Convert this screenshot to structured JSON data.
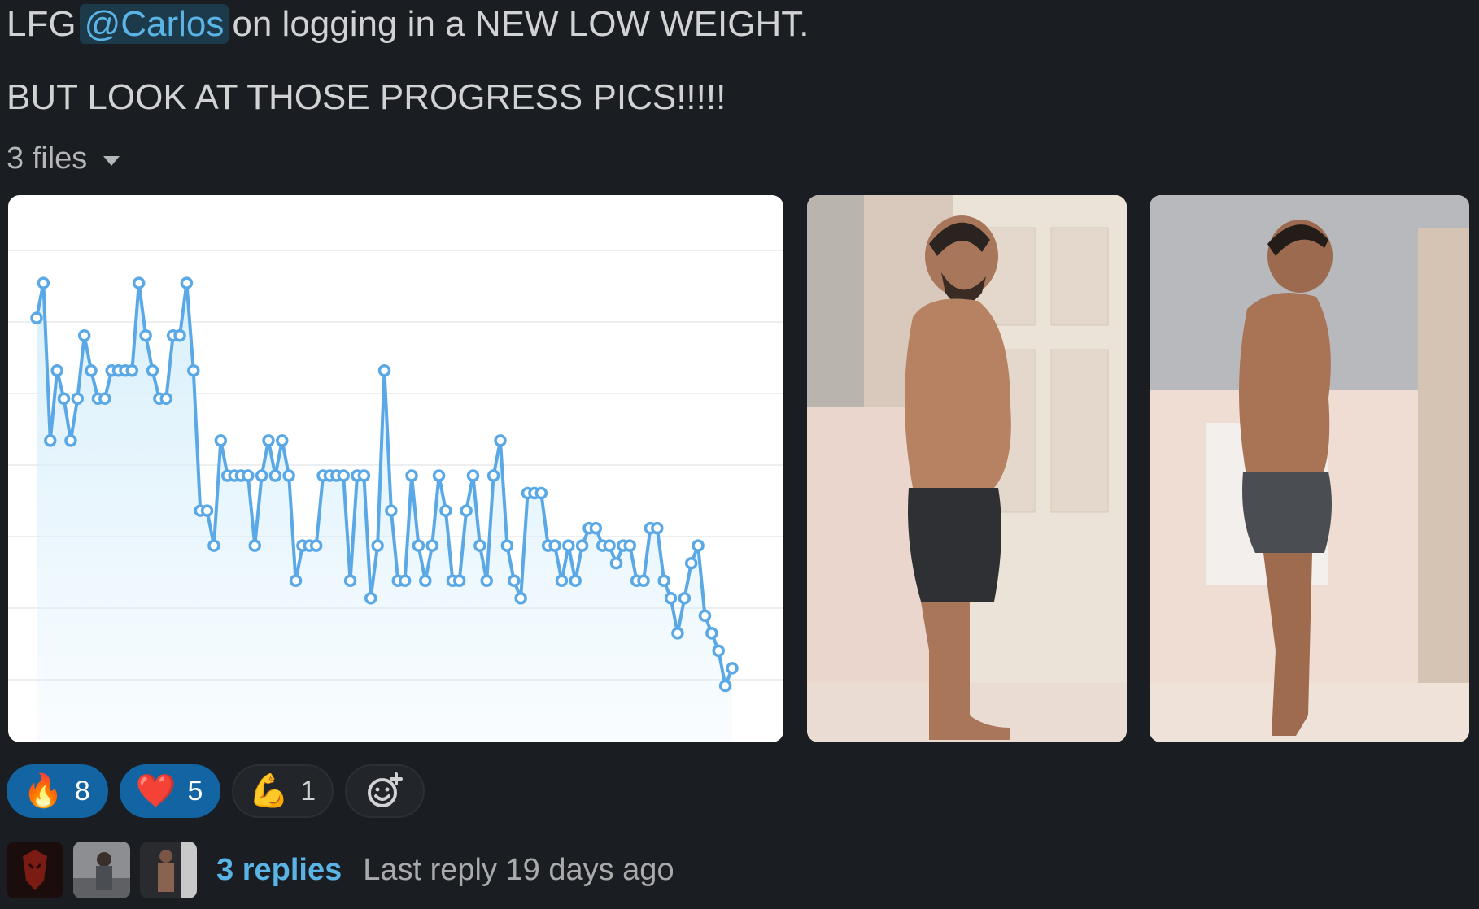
{
  "message": {
    "line1_before": "LFG",
    "mention": "@Carlos",
    "line1_after": "on logging in a NEW LOW WEIGHT.",
    "line2": "BUT LOOK AT THOSE PROGRESS PICS!!!!!",
    "files_label": "3 files"
  },
  "chart_data": {
    "type": "area",
    "values": [
      80,
      90,
      45,
      65,
      57,
      45,
      57,
      75,
      65,
      57,
      57,
      65,
      65,
      65,
      65,
      90,
      75,
      65,
      57,
      57,
      75,
      75,
      90,
      65,
      25,
      25,
      15,
      45,
      35,
      35,
      35,
      35,
      15,
      35,
      45,
      35,
      45,
      35,
      5,
      15,
      15,
      15,
      35,
      35,
      35,
      35,
      5,
      35,
      35,
      0,
      15,
      65,
      25,
      5,
      5,
      35,
      15,
      5,
      15,
      35,
      25,
      5,
      5,
      25,
      35,
      15,
      5,
      35,
      45,
      15,
      5,
      0,
      30,
      30,
      30,
      15,
      15,
      5,
      15,
      5,
      15,
      20,
      20,
      15,
      15,
      10,
      15,
      15,
      5,
      5,
      20,
      20,
      5,
      0,
      -10,
      0,
      10,
      15,
      -5,
      -10,
      -15,
      -25,
      -20
    ],
    "ylim": [
      -30,
      100
    ],
    "grid": true,
    "line_color": "#5aa9e6",
    "fill_color": "#d8effb"
  },
  "photos": [
    {
      "icon": "progress-photo-before"
    },
    {
      "icon": "progress-photo-after"
    }
  ],
  "reactions": [
    {
      "emoji": "🔥",
      "count": "8",
      "active": true
    },
    {
      "emoji": "❤️",
      "count": "5",
      "active": true
    },
    {
      "emoji": "💪",
      "count": "1",
      "active": false
    }
  ],
  "thread": {
    "replies": "3 replies",
    "last_reply": "Last reply 19 days ago"
  },
  "colors": {
    "background": "#1a1d21",
    "mention": "#5ab4e6",
    "reaction_active": "#1264a3"
  }
}
